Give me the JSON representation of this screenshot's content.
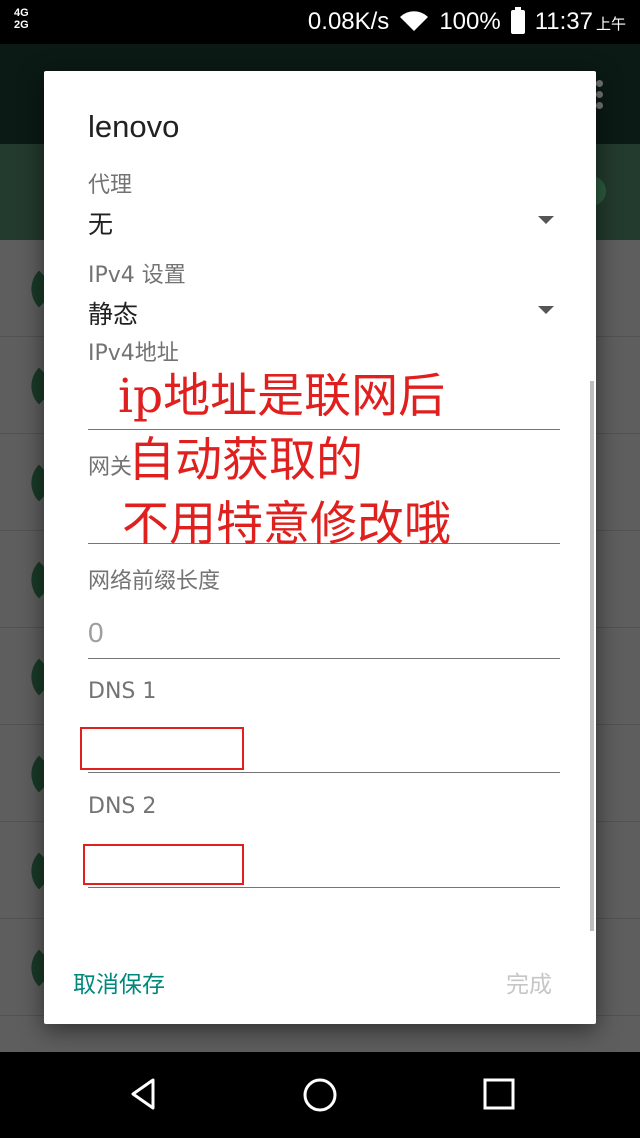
{
  "status_bar": {
    "signal_top": "4G",
    "signal_bottom": "2G",
    "speed": "0.08K/s",
    "battery": "100%",
    "time": "11:37",
    "ampm": "上午"
  },
  "dialog": {
    "title": "lenovo",
    "proxy": {
      "label": "代理",
      "value": "无"
    },
    "ipv4_settings": {
      "label": "IPv4 设置",
      "value": "静态"
    },
    "ipv4_address": {
      "label": "IPv4地址",
      "value": ""
    },
    "gateway": {
      "label": "网关",
      "value": ""
    },
    "prefix_length": {
      "label": "网络前缀长度",
      "value": "0"
    },
    "dns1": {
      "label": "DNS 1",
      "value": ""
    },
    "dns2": {
      "label": "DNS 2",
      "value": ""
    },
    "buttons": {
      "cancel_save": "取消保存",
      "done": "完成"
    }
  },
  "annotation": {
    "lines": [
      "ip地址是联网后",
      "自动获取的",
      "不用特意修改哦"
    ],
    "color": "#e0201e"
  },
  "nav_bar": {
    "icons": [
      "back-icon",
      "home-icon",
      "recents-icon"
    ]
  }
}
